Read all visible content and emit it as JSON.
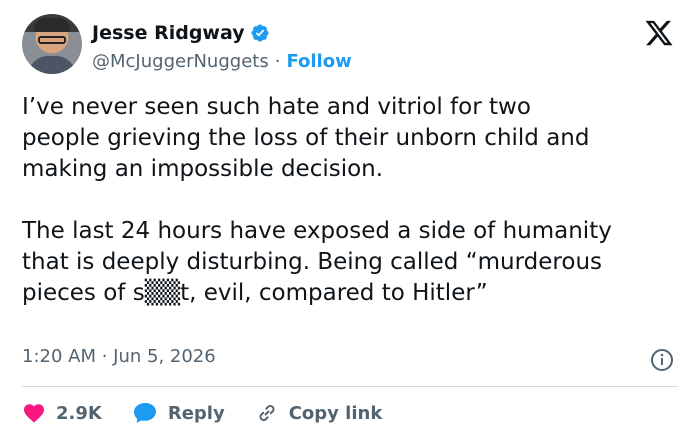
{
  "author": {
    "name": "Jesse Ridgway",
    "handle": "@McJuggerNuggets",
    "separator": "·",
    "follow_label": "Follow"
  },
  "tweet": {
    "text": "I’ve never seen such hate and vitriol for two\npeople grieving the loss of their unborn child and\nmaking an impossible decision.\n\nThe last 24 hours have exposed a side of humanity\nthat is deeply disturbing. Being called “murderous\npieces of s▒▒t, evil, compared to Hitler”",
    "timestamp": "1:20 AM · Jun 5, 2026"
  },
  "actions": {
    "like_count": "2.9K",
    "reply_label": "Reply",
    "copy_label": "Copy link"
  },
  "icons": {
    "verified": "verified-badge-icon",
    "platform": "x-logo-icon",
    "info": "info-icon",
    "like": "heart-icon",
    "reply": "speech-bubble-icon",
    "copy": "link-icon"
  },
  "colors": {
    "accent": "#1d9bf0",
    "like": "#f91880",
    "muted": "#536471",
    "text": "#0f1419"
  }
}
